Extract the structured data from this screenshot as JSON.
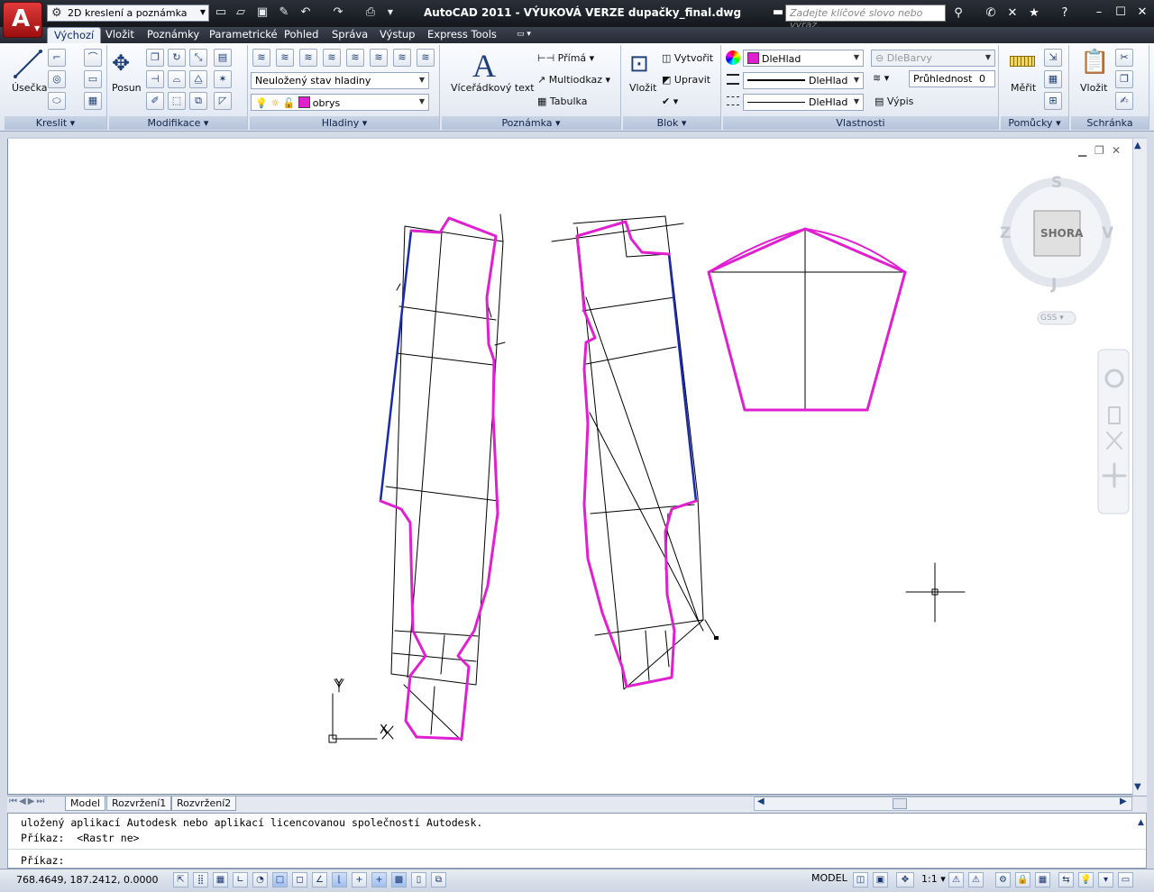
{
  "app": {
    "title": "AutoCAD 2011 - VÝUKOVÁ VERZE   dupačky_final.dwg",
    "workspace": "2D kreslení a poznámka",
    "search_placeholder": "Zadejte klíčové slovo nebo výraz."
  },
  "tabs": [
    "Výchozí",
    "Vložit",
    "Poznámky",
    "Parametrické",
    "Pohled",
    "Správa",
    "Výstup",
    "Express Tools"
  ],
  "ribbon": {
    "kreslit": {
      "label": "Kreslit",
      "line": "Úsečka"
    },
    "modifikace": {
      "label": "Modifikace",
      "move": "Posun"
    },
    "hladiny": {
      "label": "Hladiny",
      "state": "Neuložený stav hladiny",
      "layer": "obrys"
    },
    "poznamka": {
      "label": "Poznámka",
      "mtext": "Víceřádkový text",
      "linear": "Přímá",
      "mleader": "Multiodkaz",
      "table": "Tabulka"
    },
    "blok": {
      "label": "Blok",
      "insert": "Vložit",
      "create": "Vytvořit",
      "edit": "Upravit"
    },
    "vlastnosti": {
      "label": "Vlastnosti",
      "color": "DleHlad",
      "linetype": "DleHlad",
      "lineweight": "DleHlad",
      "plotstyle": "DleBarvy",
      "transparency_label": "Průhlednost",
      "transparency_value": "0",
      "list": "Výpis"
    },
    "pomucky": {
      "label": "Pomůcky",
      "measure": "Měřit"
    },
    "schranka": {
      "label": "Schránka",
      "paste": "Vložit"
    }
  },
  "viewcube": {
    "top": "SHORA",
    "north": "S",
    "south": "J",
    "east": "V",
    "west": "Z",
    "ucs": "GSS"
  },
  "ucs_icon": {
    "x": "X",
    "y": "Y"
  },
  "layout_tabs": [
    "Model",
    "Rozvržení1",
    "Rozvržení2"
  ],
  "command_lines": [
    "uložený aplikací Autodesk nebo aplikací licencovanou společností Autodesk.",
    "Příkaz:  <Rastr ne>",
    "Příkaz:"
  ],
  "status": {
    "coords": "768.4649, 187.2412, 0.0000",
    "model": "MODEL",
    "scale": "1:1"
  },
  "colors": {
    "outline": "#e020d0",
    "seam": "#1a2aa8",
    "construction": "#000000"
  }
}
